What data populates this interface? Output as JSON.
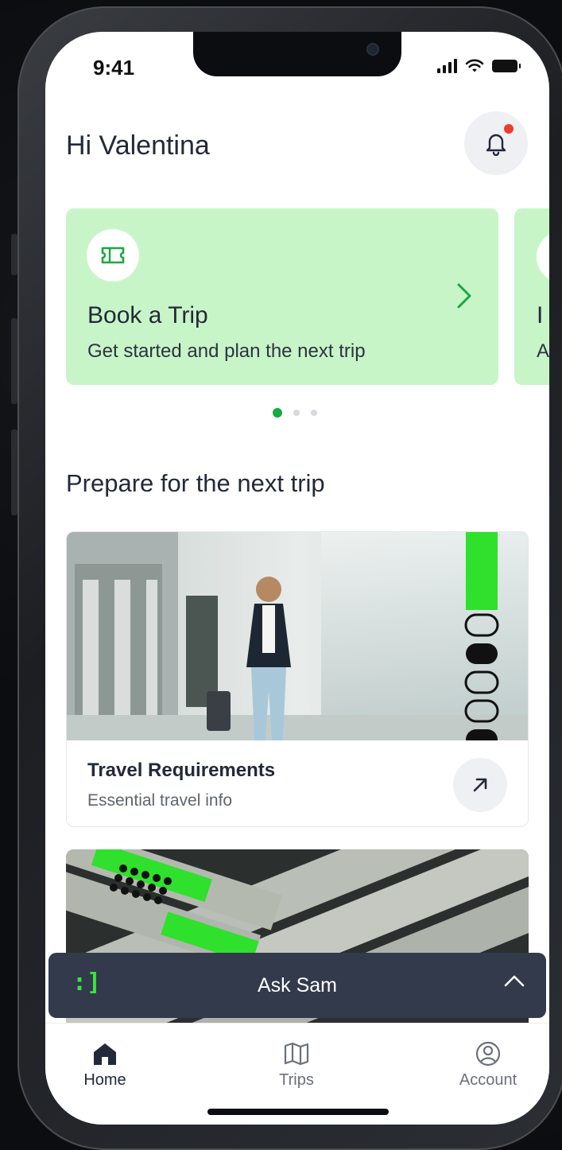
{
  "status_bar": {
    "time": "9:41"
  },
  "header": {
    "greeting": "Hi Valentina"
  },
  "carousel": {
    "cards": [
      {
        "title": "Book a Trip",
        "subtitle": "Get started and plan the next trip",
        "icon": "ticket-icon"
      },
      {
        "title": "I",
        "subtitle": "A"
      }
    ],
    "active_index": 0,
    "total": 3
  },
  "section": {
    "title": "Prepare for the next trip"
  },
  "info_card": {
    "title": "Travel Requirements",
    "subtitle": "Essential travel info",
    "icon": "arrow-up-right-icon"
  },
  "ask_bar": {
    "label": "Ask Sam",
    "logo": ":]"
  },
  "tabs": [
    {
      "label": "Home",
      "icon": "home-icon"
    },
    {
      "label": "Trips",
      "icon": "map-icon"
    },
    {
      "label": "Account",
      "icon": "account-icon"
    }
  ],
  "colors": {
    "accent": "#18a93f",
    "brand_green": "#39e63a",
    "card_bg": "#c8f5c7",
    "dark": "#323a4c",
    "notification": "#ef3b2d"
  }
}
